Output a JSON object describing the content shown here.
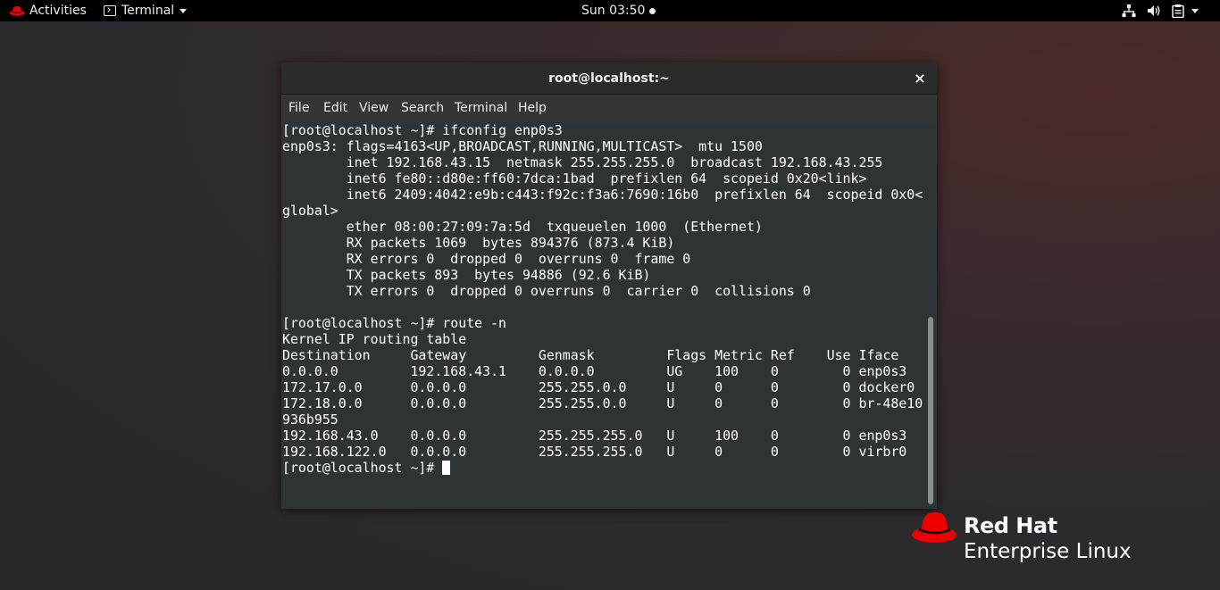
{
  "topbar": {
    "activities": "Activities",
    "app_name": "Terminal",
    "clock": "Sun 03:50",
    "icons": [
      "network-icon",
      "volume-icon",
      "clipboard-icon",
      "system-menu-caret"
    ]
  },
  "window": {
    "title": "root@localhost:~",
    "close_glyph": "×",
    "menu": [
      "File",
      "Edit",
      "View",
      "Search",
      "Terminal",
      "Help"
    ]
  },
  "terminal": {
    "lines": [
      "[root@localhost ~]# ifconfig enp0s3",
      "enp0s3: flags=4163<UP,BROADCAST,RUNNING,MULTICAST>  mtu 1500",
      "        inet 192.168.43.15  netmask 255.255.255.0  broadcast 192.168.43.255",
      "        inet6 fe80::d80e:ff60:7dca:1bad  prefixlen 64  scopeid 0x20<link>",
      "        inet6 2409:4042:e9b:c443:f92c:f3a6:7690:16b0  prefixlen 64  scopeid 0x0<",
      "global>",
      "        ether 08:00:27:09:7a:5d  txqueuelen 1000  (Ethernet)",
      "        RX packets 1069  bytes 894376 (873.4 KiB)",
      "        RX errors 0  dropped 0  overruns 0  frame 0",
      "        TX packets 893  bytes 94886 (92.6 KiB)",
      "        TX errors 0  dropped 0 overruns 0  carrier 0  collisions 0",
      "",
      "[root@localhost ~]# route -n",
      "Kernel IP routing table",
      "Destination     Gateway         Genmask         Flags Metric Ref    Use Iface",
      "0.0.0.0         192.168.43.1    0.0.0.0         UG    100    0        0 enp0s3",
      "172.17.0.0      0.0.0.0         255.255.0.0     U     0      0        0 docker0",
      "172.18.0.0      0.0.0.0         255.255.0.0     U     0      0        0 br-48e10",
      "936b955",
      "192.168.43.0    0.0.0.0         255.255.255.0   U     100    0        0 enp0s3",
      "192.168.122.0   0.0.0.0         255.255.255.0   U     0      0        0 virbr0"
    ],
    "prompt": "[root@localhost ~]# "
  },
  "branding": {
    "line1": "Red Hat",
    "line2": "Enterprise Linux",
    "colors": {
      "hat_red": "#ee0000",
      "text": "#ffffff"
    }
  }
}
